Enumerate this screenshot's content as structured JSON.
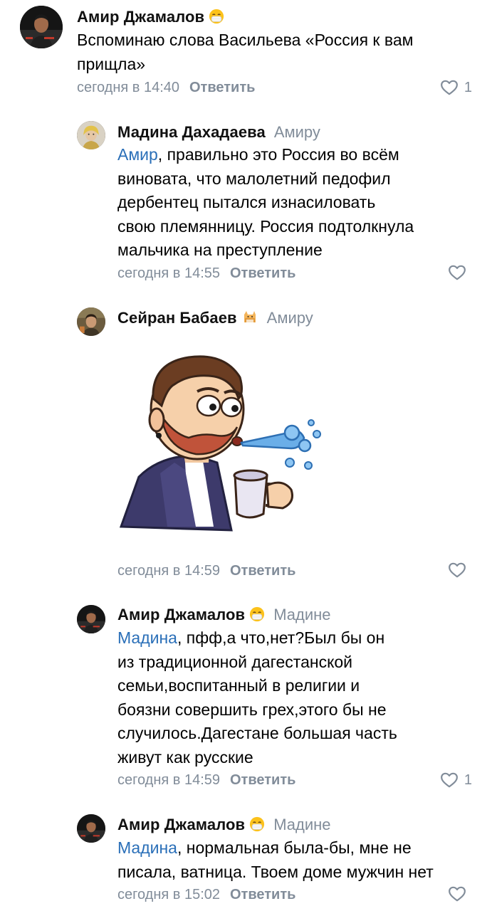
{
  "comments": [
    {
      "author": "Амир Джамалов",
      "author_emoji": "mask-face-emoji",
      "reply_to": "",
      "mention": "",
      "text": "Вспоминаю слова Васильева «Россия к вам прищла»",
      "text_line1": "Вспоминаю слова Васильева «Россия к вам",
      "text_line2": "прищла»",
      "time": "сегодня в 14:40",
      "reply_label": "Ответить",
      "likes": "1"
    },
    {
      "author": "Мадина Дахадаева",
      "reply_to": "Амиру",
      "mention": "Амир",
      "text_lines": [
        ", правильно это Россия во всём",
        "виновата, что малолетний педофил",
        "дербентец пытался изнасиловать",
        "свою племянницу. Россия подтолкнула",
        "мальчика на преступление"
      ],
      "time": "сегодня в 14:55",
      "reply_label": "Ответить",
      "likes": ""
    },
    {
      "author": "Сейран Бабаев",
      "author_emoji": "cat-emoji",
      "reply_to": "Амиру",
      "sticker": "man-spitting-coffee-sticker",
      "time": "сегодня в 14:59",
      "reply_label": "Ответить",
      "likes": ""
    },
    {
      "author": "Амир Джамалов",
      "author_emoji": "mask-face-emoji",
      "reply_to": "Мадине",
      "mention": "Мадина",
      "text_lines": [
        ", пфф,а что,нет?Был бы он",
        "из традиционной дагестанской",
        "семьи,воспитанный в религии и",
        "боязни совершить грех,этого бы не",
        "случилось.Дагестане большая часть",
        "живут как русские"
      ],
      "time": "сегодня в 14:59",
      "reply_label": "Ответить",
      "likes": "1"
    },
    {
      "author": "Амир Джамалов",
      "author_emoji": "mask-face-emoji",
      "reply_to": "Мадине",
      "mention": "Мадина",
      "text_lines": [
        ", нормальная была-бы, мне не",
        "писала, ватница. Твоем доме мужчин нет"
      ],
      "time": "сегодня в 15:02",
      "reply_label": "Ответить",
      "likes": ""
    }
  ],
  "colors": {
    "secondary": "#818c99",
    "mention": "#2a6fb8",
    "text": "#000000"
  }
}
